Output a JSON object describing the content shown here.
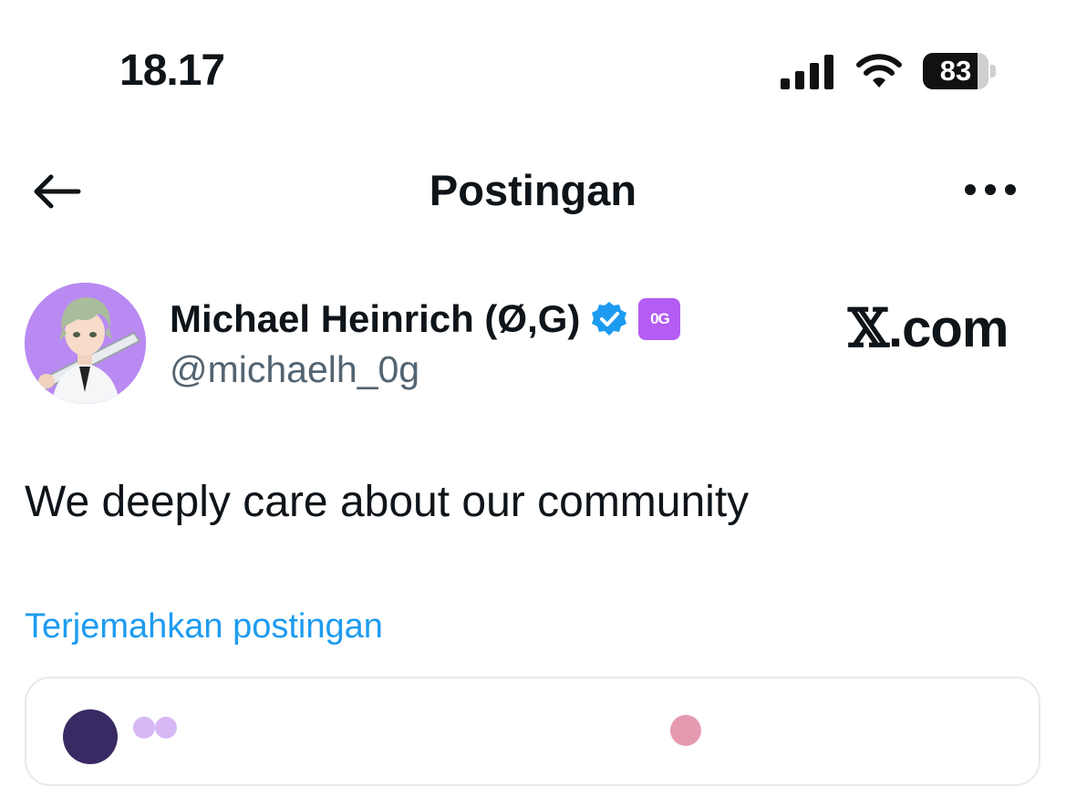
{
  "status_bar": {
    "time": "18.17",
    "battery_level": "83",
    "battery_fraction": 0.83
  },
  "header": {
    "title": "Postingan"
  },
  "post": {
    "author_name": "Michael Heinrich (Ø,G)",
    "verified": true,
    "affiliate_badge": "0G",
    "handle": "@michaelh_0g",
    "text": "We deeply care about our community",
    "translate_label": "Terjemahkan postingan"
  },
  "watermark": {
    "x": "𝕏",
    "text": ".com"
  },
  "colors": {
    "link": "#1d9bf0",
    "handle": "#536471",
    "verified": "#1d9bf0",
    "badge": "#b45cf3"
  }
}
